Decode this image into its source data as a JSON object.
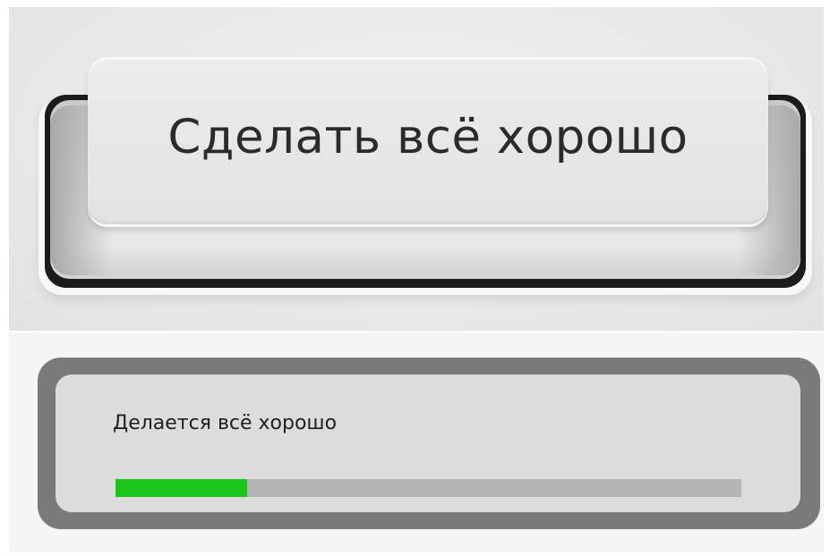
{
  "key_button": {
    "label": "Сделать всё хорошо"
  },
  "progress_dialog": {
    "status_text": "Делается всё хорошо",
    "progress_fraction": 0.21,
    "fill_color": "#1ac61a",
    "track_color": "#b5b5b5"
  }
}
